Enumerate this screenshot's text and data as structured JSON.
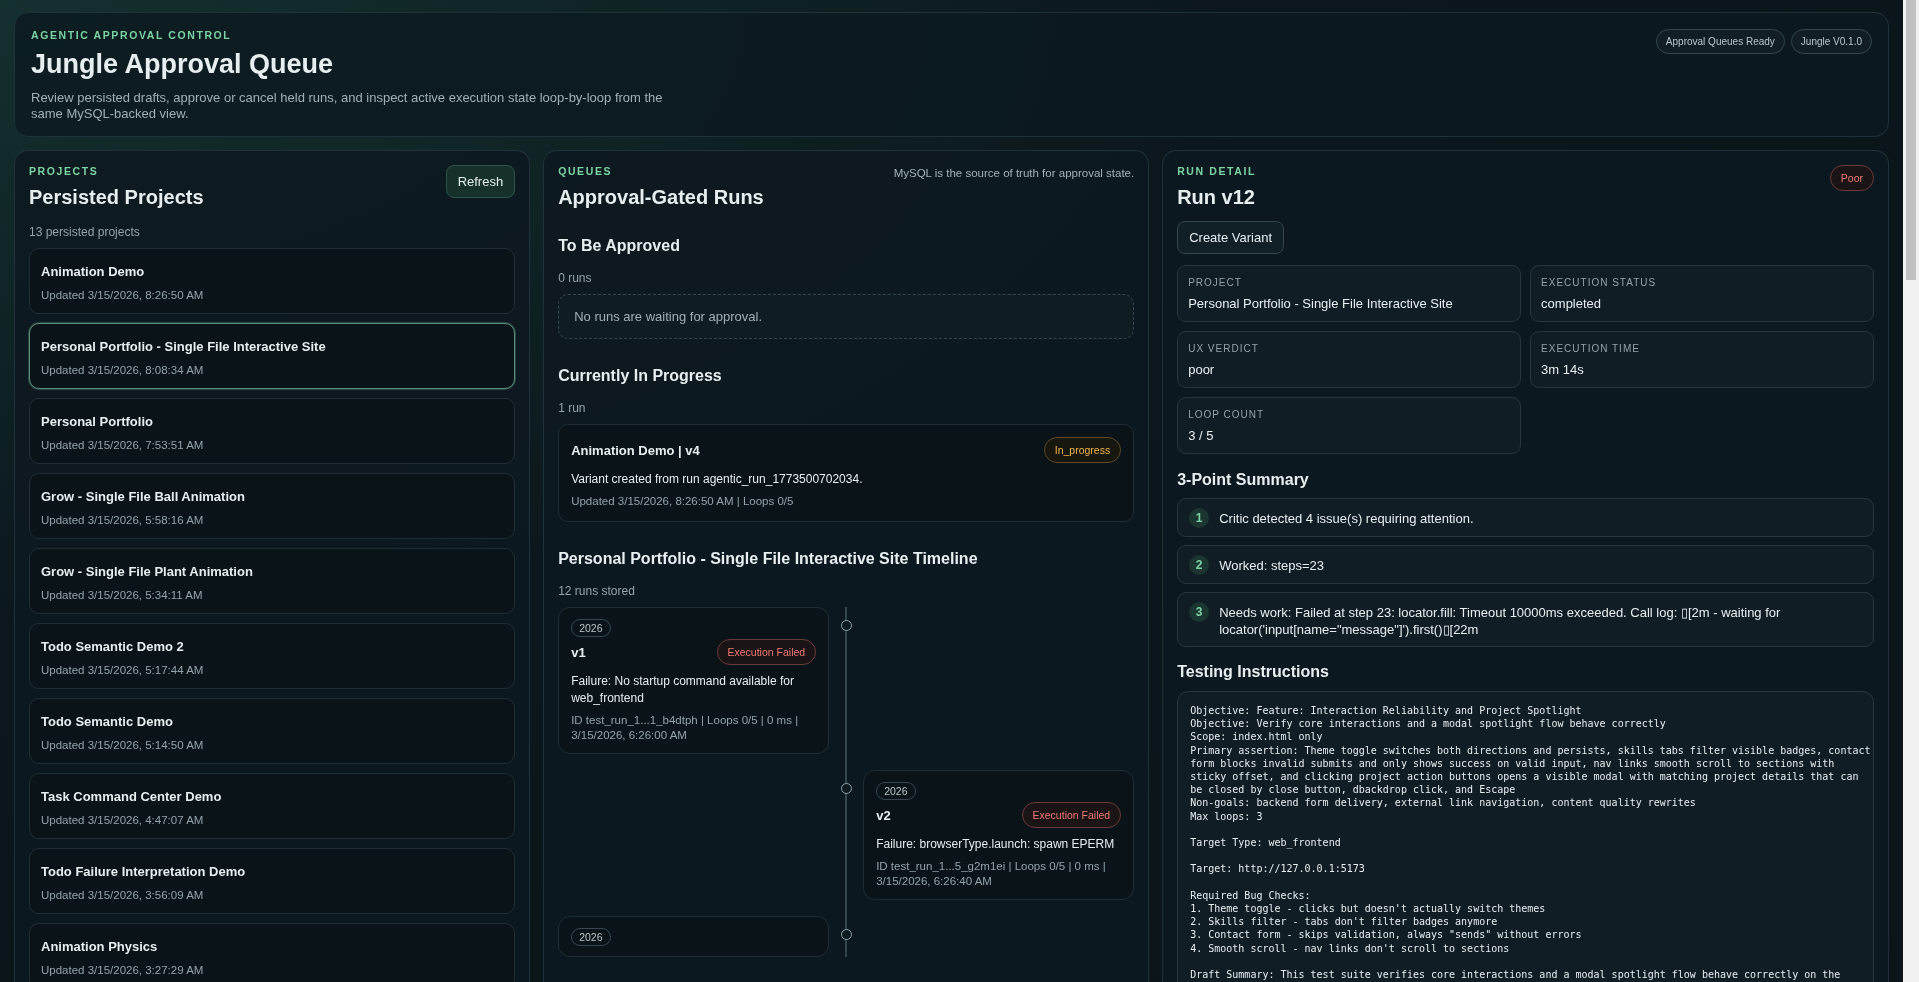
{
  "header": {
    "eyebrow": "AGENTIC APPROVAL CONTROL",
    "title": "Jungle Approval Queue",
    "description": "Review persisted drafts, approve or cancel held runs, and inspect active execution state loop-by-loop from the same MySQL-backed view.",
    "badges": [
      "Approval Queues Ready",
      "Jungle V0.1.0"
    ]
  },
  "projects": {
    "eyebrow": "PROJECTS",
    "title": "Persisted Projects",
    "refresh_button": "Refresh",
    "count": "13 persisted projects",
    "items": [
      {
        "name": "Animation Demo",
        "updated": "Updated 3/15/2026, 8:26:50 AM",
        "selected": false
      },
      {
        "name": "Personal Portfolio - Single File Interactive Site",
        "updated": "Updated 3/15/2026, 8:08:34 AM",
        "selected": true
      },
      {
        "name": "Personal Portfolio",
        "updated": "Updated 3/15/2026, 7:53:51 AM",
        "selected": false
      },
      {
        "name": "Grow - Single File Ball Animation",
        "updated": "Updated 3/15/2026, 5:58:16 AM",
        "selected": false
      },
      {
        "name": "Grow - Single File Plant Animation",
        "updated": "Updated 3/15/2026, 5:34:11 AM",
        "selected": false
      },
      {
        "name": "Todo Semantic Demo 2",
        "updated": "Updated 3/15/2026, 5:17:44 AM",
        "selected": false
      },
      {
        "name": "Todo Semantic Demo",
        "updated": "Updated 3/15/2026, 5:14:50 AM",
        "selected": false
      },
      {
        "name": "Task Command Center Demo",
        "updated": "Updated 3/15/2026, 4:47:07 AM",
        "selected": false
      },
      {
        "name": "Todo Failure Interpretation Demo",
        "updated": "Updated 3/15/2026, 3:56:09 AM",
        "selected": false
      },
      {
        "name": "Animation Physics",
        "updated": "Updated 3/15/2026, 3:27:29 AM",
        "selected": false
      }
    ]
  },
  "queues": {
    "eyebrow": "QUEUES",
    "title": "Approval-Gated Runs",
    "note": "MySQL is the source of truth for approval state.",
    "to_be_approved": {
      "title": "To Be Approved",
      "count": "0 runs",
      "empty": "No runs are waiting for approval."
    },
    "in_progress": {
      "title": "Currently In Progress",
      "count": "1 run",
      "runs": [
        {
          "title": "Animation Demo | v4",
          "status": "In_progress",
          "kind": "progress",
          "description": "Variant created from run agentic_run_1773500702034.",
          "meta": "Updated 3/15/2026, 8:26:50 AM | Loops 0/5"
        }
      ]
    },
    "timeline": {
      "title": "Personal Portfolio - Single File Interactive Site Timeline",
      "count": "12 runs stored",
      "items": [
        {
          "year": "2026",
          "version": "v1",
          "status": "Execution Failed",
          "kind": "failed",
          "failure": "Failure: No startup command available for web_frontend",
          "meta": "ID test_run_1...1_b4dtph | Loops 0/5 | 0 ms | 3/15/2026, 6:26:00 AM"
        },
        {
          "year": "2026",
          "version": "v2",
          "status": "Execution Failed",
          "kind": "failed",
          "failure": "Failure: browserType.launch: spawn EPERM",
          "meta": "ID test_run_1...5_g2m1ei | Loops 0/5 | 0 ms | 3/15/2026, 6:26:40 AM"
        },
        {
          "year": "2026"
        }
      ]
    }
  },
  "run_detail": {
    "eyebrow": "RUN DETAIL",
    "title": "Run v12",
    "verdict_badge": {
      "label": "Poor",
      "kind": "failed"
    },
    "create_variant_button": "Create Variant",
    "fields": [
      {
        "label": "PROJECT",
        "value": "Personal Portfolio - Single File Interactive Site"
      },
      {
        "label": "EXECUTION STATUS",
        "value": "completed"
      },
      {
        "label": "UX VERDICT",
        "value": "poor"
      },
      {
        "label": "EXECUTION TIME",
        "value": "3m 14s"
      },
      {
        "label": "LOOP COUNT",
        "value": "3 / 5"
      }
    ],
    "summary_title": "3-Point Summary",
    "summary": [
      {
        "number": "1",
        "text": "Critic detected 4 issue(s) requiring attention."
      },
      {
        "number": "2",
        "text": "Worked: steps=23"
      },
      {
        "number": "3",
        "text": "Needs work: Failed at step 23: locator.fill: Timeout 10000ms exceeded. Call log: ▯[2m - waiting for locator('input[name=\"message\"]').first()▯[22m"
      }
    ],
    "instructions_title": "Testing Instructions",
    "instructions": "Objective: Feature: Interaction Reliability and Project Spotlight\nObjective: Verify core interactions and a modal spotlight flow behave correctly\nScope: index.html only\nPrimary assertion: Theme toggle switches both directions and persists, skills tabs filter visible badges, contact\nform blocks invalid submits and only shows success on valid input, nav links smooth scroll to sections with\nsticky offset, and clicking project action buttons opens a visible modal with matching project details that can\nbe closed by close button, dbackdrop click, and Escape\nNon-goals: backend form delivery, external link navigation, content quality rewrites\nMax loops: 3\n\nTarget Type: web_frontend\n\nTarget: http://127.0.0.1:5173\n\nRequired Bug Checks:\n1. Theme toggle - clicks but doesn't actually switch themes\n2. Skills filter - tabs don't filter badges anymore\n3. Contact form - skips validation, always \"sends\" without errors\n4. Smooth scroll - nav links don't scroll to sections\n\nDraft Summary: This test suite verifies core interactions and a modal spotlight flow behave correctly on the"
  }
}
